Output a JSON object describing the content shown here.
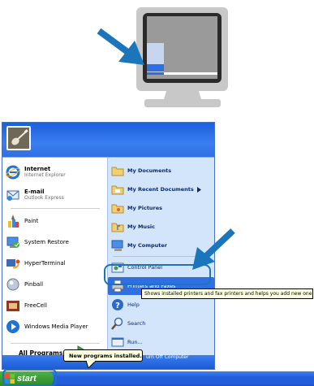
{
  "start_menu": {
    "left_items": [
      {
        "label": "Internet",
        "sublabel": "Internet Explorer",
        "icon": "internet-explorer-icon"
      },
      {
        "label": "E-mail",
        "sublabel": "Outlook Express",
        "icon": "outlook-express-icon"
      },
      {
        "label": "Paint",
        "icon": "paint-icon"
      },
      {
        "label": "System Restore",
        "icon": "system-restore-icon"
      },
      {
        "label": "HyperTerminal",
        "icon": "hyperterminal-icon"
      },
      {
        "label": "Pinball",
        "icon": "pinball-icon"
      },
      {
        "label": "FreeCell",
        "icon": "freecell-icon"
      },
      {
        "label": "Windows Media Player",
        "icon": "media-player-icon"
      }
    ],
    "all_programs_label": "All Programs",
    "right_items": [
      {
        "label": "My Documents",
        "icon": "folder-icon"
      },
      {
        "label": "My Recent Documents",
        "icon": "folder-recent-icon"
      },
      {
        "label": "My Pictures",
        "icon": "folder-pictures-icon"
      },
      {
        "label": "My Music",
        "icon": "folder-music-icon"
      },
      {
        "label": "My Computer",
        "icon": "computer-icon"
      },
      {
        "label": "Control Panel",
        "icon": "control-panel-icon"
      },
      {
        "label": "Printers and Faxes",
        "icon": "printer-icon"
      },
      {
        "label": "Help",
        "icon": "help-icon"
      },
      {
        "label": "Search",
        "icon": "search-icon"
      },
      {
        "label": "Run...",
        "icon": "run-icon"
      }
    ],
    "tooltip": "Shows installed printers and fax printers and helps you add new one",
    "balloon": "New programs installed.",
    "shutdown_label": "urn Off Computer"
  },
  "taskbar": {
    "start_label": "start"
  },
  "colors": {
    "arrow": "#1b75bb",
    "menu_blue": "#2f6fe2",
    "start_green": "#3a9a36"
  }
}
